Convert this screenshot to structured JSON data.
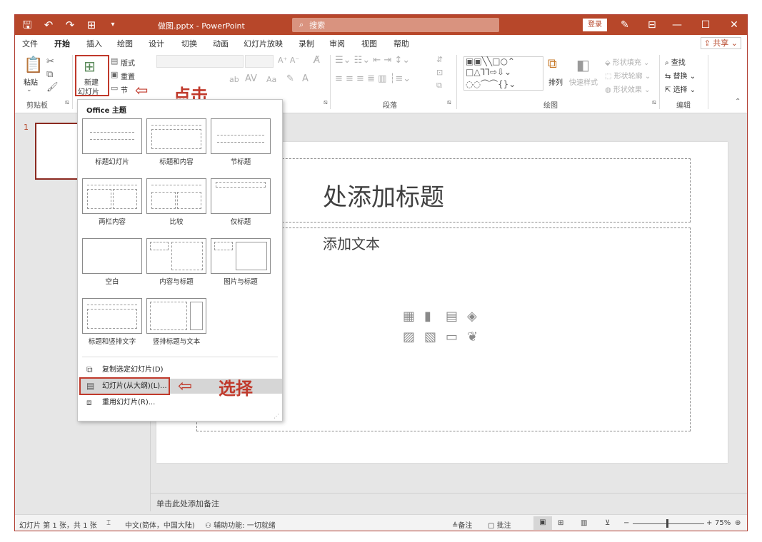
{
  "titlebar": {
    "doc_title": "做图.pptx  -  PowerPoint",
    "search": "搜索",
    "login": "登录"
  },
  "tabs": [
    "文件",
    "开始",
    "插入",
    "绘图",
    "设计",
    "切换",
    "动画",
    "幻灯片放映",
    "录制",
    "审阅",
    "视图",
    "帮助"
  ],
  "active_tab": "开始",
  "share": "共享",
  "ribbon": {
    "paste": "粘贴",
    "new_slide_line1": "新建",
    "new_slide_line2": "幻灯片",
    "layout": "版式",
    "reset": "重置",
    "section": "节",
    "arrange": "排列",
    "quick_styles": "快速样式",
    "shape_fill": "形状填充",
    "shape_outline": "形状轮廓",
    "shape_effects": "形状效果",
    "find": "查找",
    "replace": "替换",
    "select": "选择",
    "groups": {
      "clipboard": "剪贴板",
      "paragraph": "段落",
      "drawing": "绘图",
      "editing": "编辑"
    },
    "font_size_glyphs": "A⁺ A⁻",
    "case_glyph": "Aa"
  },
  "annotations": {
    "click": "点击",
    "select": "选择"
  },
  "dropdown": {
    "header": "Office 主题",
    "layouts": [
      "标题幻灯片",
      "标题和内容",
      "节标题",
      "两栏内容",
      "比较",
      "仅标题",
      "空白",
      "内容与标题",
      "图片与标题",
      "标题和竖排文字",
      "竖排标题与文本"
    ],
    "items": [
      "复制选定幻灯片(D)",
      "幻灯片(从大纲)(L)...",
      "重用幻灯片(R)..."
    ]
  },
  "thumbnails": {
    "slide_number": "1"
  },
  "slide": {
    "title_placeholder": "处添加标题",
    "body_placeholder": "添加文本"
  },
  "notes_placeholder": "单击此处添加备注",
  "statusbar": {
    "slide_info": "幻灯片 第 1 张，共 1 张",
    "language": "中文(简体，中国大陆)",
    "accessibility": "辅助功能: 一切就绪",
    "notes": "备注",
    "comments": "批注",
    "zoom": "75%"
  },
  "colors": {
    "accent": "#b7472a",
    "annotation_red": "#c0392b"
  }
}
